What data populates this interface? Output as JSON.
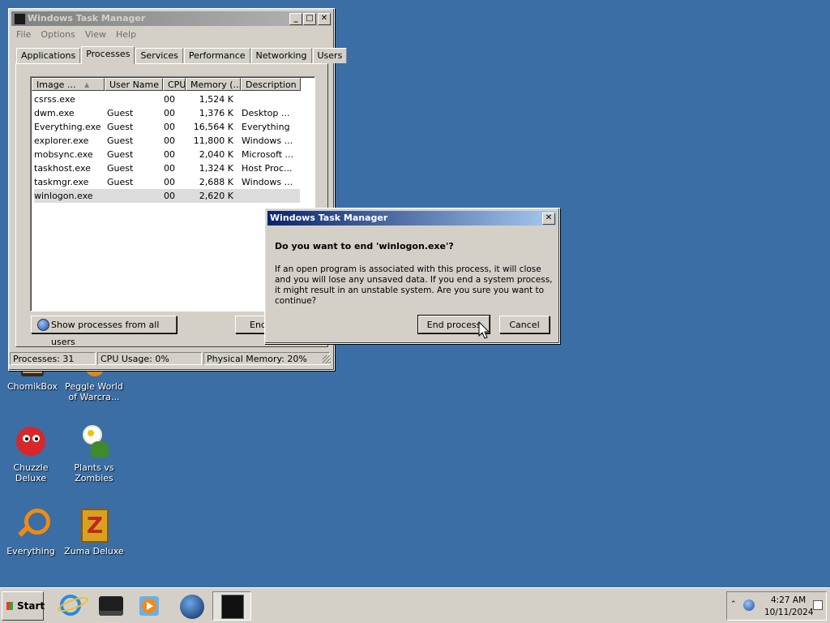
{
  "taskmgr": {
    "title": "Windows Task Manager",
    "menu": [
      "File",
      "Options",
      "View",
      "Help"
    ],
    "tabs": [
      "Applications",
      "Processes",
      "Services",
      "Performance",
      "Networking",
      "Users"
    ],
    "columns": [
      "Image ...",
      "User Name",
      "CPU",
      "Memory (...",
      "Description"
    ],
    "rows": [
      {
        "image": "csrss.exe",
        "user": "",
        "cpu": "00",
        "mem": "1,524 K",
        "desc": ""
      },
      {
        "image": "dwm.exe",
        "user": "Guest",
        "cpu": "00",
        "mem": "1,376 K",
        "desc": "Desktop ..."
      },
      {
        "image": "Everything.exe",
        "user": "Guest",
        "cpu": "00",
        "mem": "16,564 K",
        "desc": "Everything"
      },
      {
        "image": "explorer.exe",
        "user": "Guest",
        "cpu": "00",
        "mem": "11,800 K",
        "desc": "Windows ..."
      },
      {
        "image": "mobsync.exe",
        "user": "Guest",
        "cpu": "00",
        "mem": "2,040 K",
        "desc": "Microsoft ..."
      },
      {
        "image": "taskhost.exe",
        "user": "Guest",
        "cpu": "00",
        "mem": "1,324 K",
        "desc": "Host Proc..."
      },
      {
        "image": "taskmgr.exe",
        "user": "Guest",
        "cpu": "00",
        "mem": "2,688 K",
        "desc": "Windows ..."
      },
      {
        "image": "winlogon.exe",
        "user": "",
        "cpu": "00",
        "mem": "2,620 K",
        "desc": ""
      }
    ],
    "show_all_label": "Show processes from all users",
    "end_label": "End",
    "status": {
      "processes": "Processes: 31",
      "cpu": "CPU Usage: 0%",
      "memory": "Physical Memory: 20%"
    }
  },
  "dialog": {
    "title": "Windows Task Manager",
    "heading": "Do you want to end 'winlogon.exe'?",
    "body": "If an open program is associated with this process, it will close and you will lose any unsaved data. If you end a system process, it might result in an unstable system. Are you sure you want to continue?",
    "end_button": "End process",
    "cancel_button": "Cancel",
    "close_glyph": "✕"
  },
  "desktop": {
    "icons": [
      {
        "label": "ChomikBox"
      },
      {
        "label": "Peggle World of Warcra..."
      },
      {
        "label": "Chuzzle Deluxe"
      },
      {
        "label": "Plants vs Zombies"
      },
      {
        "label": "Everything"
      },
      {
        "label": "Zuma Deluxe"
      }
    ]
  },
  "taskbar": {
    "start_label": "Start",
    "time": "4:27 AM",
    "date": "10/11/2024",
    "quick_launch": [
      "ie-icon",
      "chomikbox-icon",
      "media-player-icon",
      "globe-icon",
      "taskmgr-icon"
    ]
  },
  "colors": {
    "desktop": "#3a6ea5",
    "titlebar_active": "#0a246a",
    "face": "#d4d0c8"
  }
}
